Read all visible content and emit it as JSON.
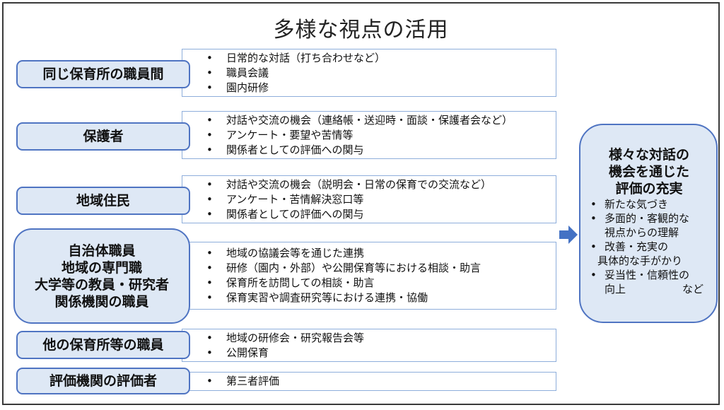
{
  "title": "多様な視点の活用",
  "colors": {
    "label_fill": "#dee8f5",
    "label_border": "#4f74c2",
    "box_border": "#8eaedb",
    "arrow": "#4472c4"
  },
  "rows": [
    {
      "label_lines": [
        "同じ保育所の職員間"
      ],
      "items": [
        "日常的な対話（打ち合わせなど）",
        "職員会議",
        "園内研修"
      ]
    },
    {
      "label_lines": [
        "保護者"
      ],
      "items": [
        "対話や交流の機会（連絡帳・送迎時・面談・保護者会など）",
        "アンケート・要望や苦情等",
        "関係者としての評価への関与"
      ]
    },
    {
      "label_lines": [
        "地域住民"
      ],
      "items": [
        "対話や交流の機会（説明会・日常の保育での交流など）",
        "アンケート・苦情解決窓口等",
        "関係者としての評価への関与"
      ]
    },
    {
      "label_lines": [
        "自治体職員",
        "地域の専門職",
        "大学等の教員・研究者",
        "関係機関の職員"
      ],
      "items": [
        "地域の協議会等を通じた連携",
        "研修（園内・外部）や公開保育等における相談・助言",
        "保育所を訪問しての相談・助言",
        "保育実習や調査研究等における連携・協働"
      ]
    },
    {
      "label_lines": [
        "他の保育所等の職員"
      ],
      "items": [
        "地域の研修会・研究報告会等",
        "公開保育"
      ]
    },
    {
      "label_lines": [
        "評価機関の評価者"
      ],
      "items": [
        "第三者評価"
      ]
    }
  ],
  "result": {
    "heading_lines": [
      "様々な対話の",
      "機会を通じた",
      "評価の充実"
    ],
    "items": [
      {
        "lines": [
          "新たな気づき"
        ]
      },
      {
        "lines": [
          "多面的・客観的な",
          "視点からの理解"
        ]
      },
      {
        "lines": [
          "改善・充実の",
          "具体的な手がかり"
        ]
      },
      {
        "lines": [
          "妥当性・信頼性の",
          "向上"
        ],
        "suffix": "など"
      }
    ]
  },
  "icons": {
    "arrow": "arrow-right-icon"
  }
}
